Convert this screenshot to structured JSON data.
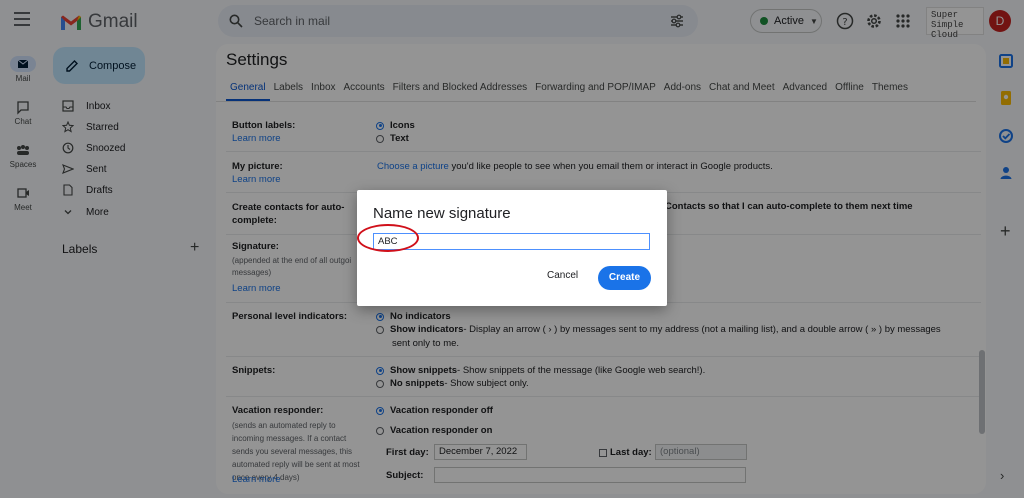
{
  "header": {
    "app_name": "Gmail",
    "search_placeholder": "Search in mail",
    "status": "Active",
    "brand_logo_text": "Super Simple Cloud",
    "avatar_initial": "D"
  },
  "rail": {
    "items": [
      {
        "label": "Mail",
        "icon": "mail-icon"
      },
      {
        "label": "Chat",
        "icon": "chat-icon"
      },
      {
        "label": "Spaces",
        "icon": "spaces-icon"
      },
      {
        "label": "Meet",
        "icon": "meet-icon"
      }
    ]
  },
  "sidebar": {
    "compose": "Compose",
    "items": [
      {
        "label": "Inbox",
        "icon": "inbox-icon"
      },
      {
        "label": "Starred",
        "icon": "star-icon"
      },
      {
        "label": "Snoozed",
        "icon": "clock-icon"
      },
      {
        "label": "Sent",
        "icon": "send-icon"
      },
      {
        "label": "Drafts",
        "icon": "draft-icon"
      },
      {
        "label": "More",
        "icon": "chevron-down-icon"
      }
    ],
    "labels_heading": "Labels",
    "labels_add": "+"
  },
  "settings": {
    "title": "Settings",
    "tabs": [
      "General",
      "Labels",
      "Inbox",
      "Accounts",
      "Filters and Blocked Addresses",
      "Forwarding and POP/IMAP",
      "Add-ons",
      "Chat and Meet",
      "Advanced",
      "Offline",
      "Themes"
    ],
    "learn_more": "Learn more",
    "button_labels": {
      "label": "Button labels:",
      "options": [
        "Icons",
        "Text"
      ]
    },
    "my_picture": {
      "label": "My picture:",
      "link": "Choose a picture",
      "text": " you'd like people to see when you email them or interact in Google products."
    },
    "create_contacts": {
      "label": "Create contacts for auto-complete:",
      "text": "Contacts so that I can auto-complete to them next time"
    },
    "signature": {
      "label": "Signature:",
      "sub": "(appended at the end of all outgoi messages)"
    },
    "personal_level": {
      "label": "Personal level indicators:",
      "option1": "No indicators",
      "option2_bold": "Show indicators",
      "option2_text": " - Display an arrow ( › ) by messages sent to my address (not a mailing list), and a double arrow ( » ) by messages",
      "option2_cont": "sent only to me."
    },
    "snippets": {
      "label": "Snippets:",
      "option1_bold": "Show snippets",
      "option1_text": " - Show snippets of the message (like Google web search!).",
      "option2_bold": "No snippets",
      "option2_text": " - Show subject only."
    },
    "vacation": {
      "label": "Vacation responder:",
      "sub": "(sends an automated reply to incoming messages. If a contact sends you several messages, this automated reply will be sent at most once every 4 days)",
      "off": "Vacation responder off",
      "on": "Vacation responder on",
      "first_day_label": "First day:",
      "first_day_value": "December 7, 2022",
      "last_day_label": "Last day:",
      "last_day_placeholder": "(optional)",
      "subject_label": "Subject:"
    }
  },
  "dialog": {
    "title": "Name new signature",
    "input_value": "ABC",
    "cancel": "Cancel",
    "create": "Create"
  },
  "colors": {
    "accent": "#1a73e8",
    "compose_bg": "#c2e7ff",
    "annotation": "#d0101a"
  }
}
